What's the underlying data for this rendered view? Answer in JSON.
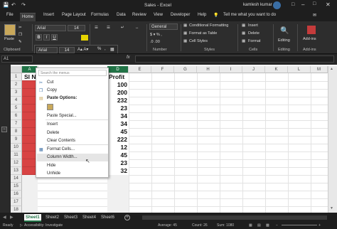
{
  "titlebar": {
    "doc_title": "Sales - Excel",
    "user_name": "kamlesh kumar"
  },
  "tabs": [
    "File",
    "Home",
    "Insert",
    "Page Layout",
    "Formulas",
    "Data",
    "Review",
    "View",
    "Developer",
    "Help"
  ],
  "tell_me": "Tell me what you want to do",
  "ribbon": {
    "paste_label": "Paste",
    "font_name": "Arial",
    "font_size": "14",
    "number_format": "General",
    "cond_format": "Conditional Formatting",
    "format_table": "Format as Table",
    "cell_styles": "Cell Styles",
    "insert": "Insert",
    "delete": "Delete",
    "format": "Format",
    "editing": "Editing",
    "addins": "Add-ins",
    "groups": {
      "clipboard": "Clipboard",
      "font": "F",
      "number": "Number",
      "styles": "Styles",
      "cells": "Cells",
      "editing": "Editing",
      "addins": "Add-ins"
    }
  },
  "minitoolbar": {
    "font_name": "Arial",
    "font_size": "14",
    "percent": "%",
    "comma": ","
  },
  "namebox": "A1",
  "columns": [
    "A",
    "B",
    "C",
    "D",
    "E",
    "F",
    "G",
    "H",
    "I",
    "J",
    "K",
    "L",
    "M"
  ],
  "rows": [
    "1",
    "2",
    "3",
    "4",
    "5",
    "6",
    "7",
    "8",
    "9",
    "10",
    "11",
    "12",
    "13",
    "14",
    "15",
    "16",
    "17",
    "18"
  ],
  "cells": {
    "a1": "Sl N",
    "d_header": "Profit",
    "d_values": [
      "100",
      "200",
      "232",
      "23",
      "34",
      "34",
      "45",
      "222",
      "12",
      "45",
      "23",
      "32"
    ]
  },
  "context_menu": {
    "search_placeholder": "Search the menus",
    "cut": "Cut",
    "copy": "Copy",
    "paste_options": "Paste Options:",
    "paste_special": "Paste Special...",
    "insert": "Insert",
    "delete": "Delete",
    "clear_contents": "Clear Contents",
    "format_cells": "Format Cells...",
    "column_width": "Column Width...",
    "hide": "Hide",
    "unhide": "Unhide"
  },
  "sheets": [
    "Sheet1",
    "Sheet2",
    "Sheet3",
    "Sheet4",
    "Sheet6"
  ],
  "status": {
    "ready": "Ready",
    "accessibility": "Accessibility: Investigate",
    "average": "Average: 45",
    "count": "Count: 26",
    "sum": "Sum: 1080"
  },
  "colors": {
    "accent_green": "#217346",
    "selected_red": "#d84343",
    "dark_bg": "#1e1e1e"
  }
}
